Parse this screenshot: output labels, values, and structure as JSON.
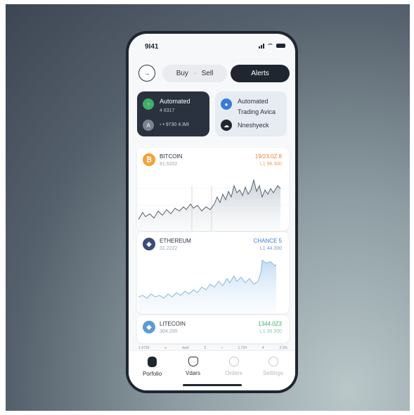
{
  "status": {
    "time": "9I41"
  },
  "top_bar": {
    "buy_label": "Buy",
    "separator": "·",
    "sell_label": "Sell",
    "alerts_label": "Alerts"
  },
  "cards": {
    "automated": {
      "title": "Automated",
      "value": "4 8317",
      "footer": "• 9730 4.IMI"
    },
    "trading": {
      "title": "Automated",
      "subtitle": "Trading Avica",
      "footer": "Nneshyeck"
    }
  },
  "coins": [
    {
      "name": "BITCOIN",
      "sub": "91,5202",
      "val1": "19/23.0Z 8",
      "val2": "L1 96.300",
      "color": "#f2a33a",
      "val_color": "#e8823a",
      "symbol": "₿"
    },
    {
      "name": "ETHEREUM",
      "sub": "31.2222",
      "val1": "CHANCE 5",
      "val2": "L1 44.300",
      "color": "#3c4b7a",
      "val_color": "#3a7bd5",
      "symbol": "◆"
    },
    {
      "name": "LITECOIN",
      "sub": "304.200",
      "val1": "1344.0Z3",
      "val2": "L1 35.300",
      "color": "#5b9bd5",
      "val_color": "#3fb06a",
      "symbol": "◆"
    }
  ],
  "ticker": [
    "1.4729",
    "●",
    "4nel",
    "2",
    "•",
    "1.724",
    "4",
    "2.3%"
  ],
  "tabs": [
    {
      "label": "Porfolio",
      "active": true
    },
    {
      "label": "Vdars",
      "active": false
    },
    {
      "label": "Orders",
      "active": false
    },
    {
      "label": "Settings",
      "active": false
    }
  ],
  "colors": {
    "dark": "#1f2630",
    "accent_orange": "#f2a33a",
    "accent_green": "#3fb06a",
    "accent_blue": "#3a7bd5"
  }
}
